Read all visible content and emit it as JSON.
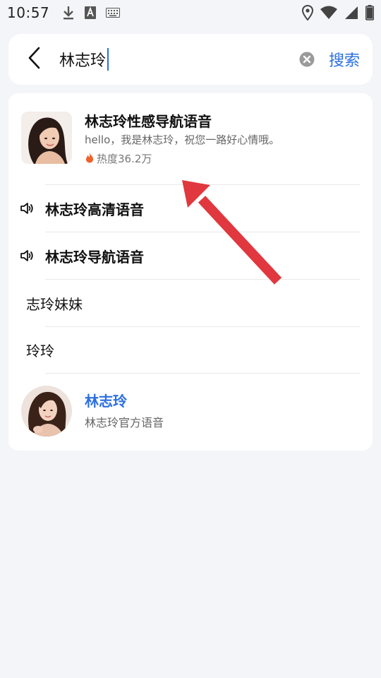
{
  "status_bar": {
    "time": "10:57",
    "left_icons": [
      "download-icon",
      "font-a-icon",
      "keyboard-icon"
    ],
    "right_icons": [
      "location-icon",
      "wifi-icon",
      "signal-icon",
      "battery-icon"
    ]
  },
  "search": {
    "query": "林志玲",
    "search_button": "搜索",
    "icons": {
      "back": "chevron-left-icon",
      "clear": "clear-circle-icon"
    }
  },
  "top_result": {
    "title": "林志玲性感导航语音",
    "description": "hello，我是林志玲，祝您一路好心情哦。",
    "heat": "热度36.2万",
    "heat_icon": "flame-icon",
    "heat_color": "#f0612a"
  },
  "suggestions": [
    {
      "label": "林志玲高清语音",
      "icon": "speaker-icon"
    },
    {
      "label": "林志玲导航语音",
      "icon": "speaker-icon"
    },
    {
      "label": "志玲妹妹",
      "icon": ""
    },
    {
      "label": "玲玲",
      "icon": ""
    }
  ],
  "artist": {
    "name": "林志玲",
    "subtitle": "林志玲官方语音"
  },
  "colors": {
    "accent": "#2b6fe0",
    "annotation_arrow": "#e0383e",
    "background": "#f4f5f8"
  }
}
